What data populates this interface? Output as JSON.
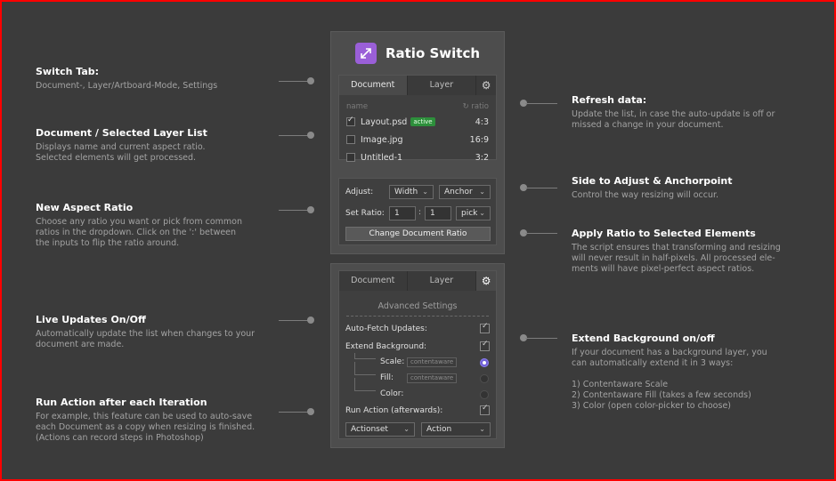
{
  "app": {
    "title": "Ratio Switch"
  },
  "panel1": {
    "tabs": [
      "Document",
      "Layer"
    ],
    "list_header": {
      "name": "name",
      "ratio": "ratio"
    },
    "rows": [
      {
        "name": "Layout.psd",
        "badge": "active",
        "ratio": "4:3",
        "checked": true
      },
      {
        "name": "Image.jpg",
        "ratio": "16:9",
        "checked": false
      },
      {
        "name": "Untitled-1",
        "ratio": "3:2",
        "checked": false
      }
    ],
    "adjust_label": "Adjust:",
    "adjust_side": "Width",
    "anchor": "Anchor",
    "set_ratio_label": "Set Ratio:",
    "ratio_a": "1",
    "ratio_sep": ":",
    "ratio_b": "1",
    "pick": "pick",
    "change_button": "Change Document Ratio"
  },
  "panel2": {
    "tabs": [
      "Document",
      "Layer"
    ],
    "section_title": "Advanced Settings",
    "auto_fetch": "Auto-Fetch Updates:",
    "extend_bg": "Extend Background:",
    "scale": "Scale:",
    "fill": "Fill:",
    "color": "Color:",
    "chip": "contentaware",
    "run_action": "Run Action (afterwards):",
    "actionset": "Actionset",
    "action": "Action"
  },
  "annotations": {
    "switch_tab": {
      "title": "Switch Tab:",
      "body": "Document-, Layer/Artboard-Mode, Settings"
    },
    "doc_list": {
      "title": "Document / Selected Layer List",
      "body": "Displays name and current aspect ratio.\nSelected elements will get processed."
    },
    "new_ratio": {
      "title": "New Aspect Ratio",
      "body": "Choose any ratio you want or pick from common\nratios in the dropdown. Click on the ':' between\nthe inputs to flip the ratio around."
    },
    "live_updates": {
      "title": "Live Updates On/Off",
      "body": "Automatically update the list when changes to your\ndocument are made."
    },
    "run_action": {
      "title": "Run Action after each Iteration",
      "body": "For example, this feature can be used to auto-save\neach Document as a copy when resizing is finished.\n(Actions can record steps in Photoshop)"
    },
    "refresh": {
      "title": "Refresh data:",
      "body": "Update the list, in case the auto-update is off or\nmissed a change in your document."
    },
    "side_adjust": {
      "title": "Side to Adjust & Anchorpoint",
      "body": "Control the way resizing will occur."
    },
    "apply_ratio": {
      "title": "Apply Ratio to Selected Elements",
      "body": "The script ensures that transforming and resizing\nwill never result in half-pixels. All processed ele-\nments will have pixel-perfect aspect ratios."
    },
    "extend_bg": {
      "title": "Extend Background on/off",
      "body": "If your document has a background layer, you\ncan automatically extend it in 3 ways:\n\n1) Contentaware Scale\n2) Contentaware Fill (takes a few seconds)\n3) Color (open color-picker to choose)"
    }
  },
  "colors": {
    "accent": "#9a5fd8",
    "badge": "#2d8f3b",
    "radio_on": "#6f5fd6",
    "background": "#3b3b3b",
    "frame": "#ff0000"
  },
  "icons": [
    "resize-arrows-icon",
    "gear-icon",
    "refresh-icon",
    "chevron-down-icon",
    "checkbox-icon"
  ]
}
